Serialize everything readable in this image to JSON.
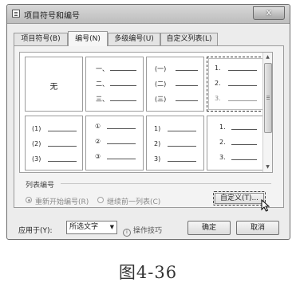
{
  "window": {
    "title": "项目符号和编号",
    "close_glyph": "x"
  },
  "tabs": [
    {
      "label": "项目符号(B)",
      "active": false
    },
    {
      "label": "编号(N)",
      "active": true
    },
    {
      "label": "多级编号(U)",
      "active": false
    },
    {
      "label": "自定义列表(L)",
      "active": false
    }
  ],
  "gallery": {
    "none_label": "无",
    "styles": [
      {
        "name": "none",
        "markers": []
      },
      {
        "name": "chinese-dun",
        "markers": [
          "一、",
          "二、",
          "三、"
        ]
      },
      {
        "name": "chinese-paren",
        "markers": [
          "(一)",
          "(二)",
          "(三)"
        ]
      },
      {
        "name": "arabic-dot",
        "markers": [
          "1.",
          "2.",
          "3."
        ],
        "selected": true
      },
      {
        "name": "arabic-paren",
        "markers": [
          "(1)",
          "(2)",
          "(3)"
        ]
      },
      {
        "name": "circled",
        "markers": [
          "①",
          "②",
          "③"
        ]
      },
      {
        "name": "arabic-half-paren",
        "markers": [
          "1)",
          "2)",
          "3)"
        ]
      },
      {
        "name": "arabic-dot-indent",
        "markers": [
          "1.",
          "2.",
          "3."
        ]
      }
    ]
  },
  "list_numbering": {
    "label": "列表编号",
    "restart_label": "重新开始编号(R)",
    "continue_label": "继续前一列表(C)",
    "custom_button": "自定义(T)..."
  },
  "footer": {
    "apply_label": "应用于(Y):",
    "apply_value": "所选文字",
    "tips_label": "操作技巧",
    "ok_button": "确定",
    "cancel_button": "取消"
  },
  "caption": "图4-36"
}
